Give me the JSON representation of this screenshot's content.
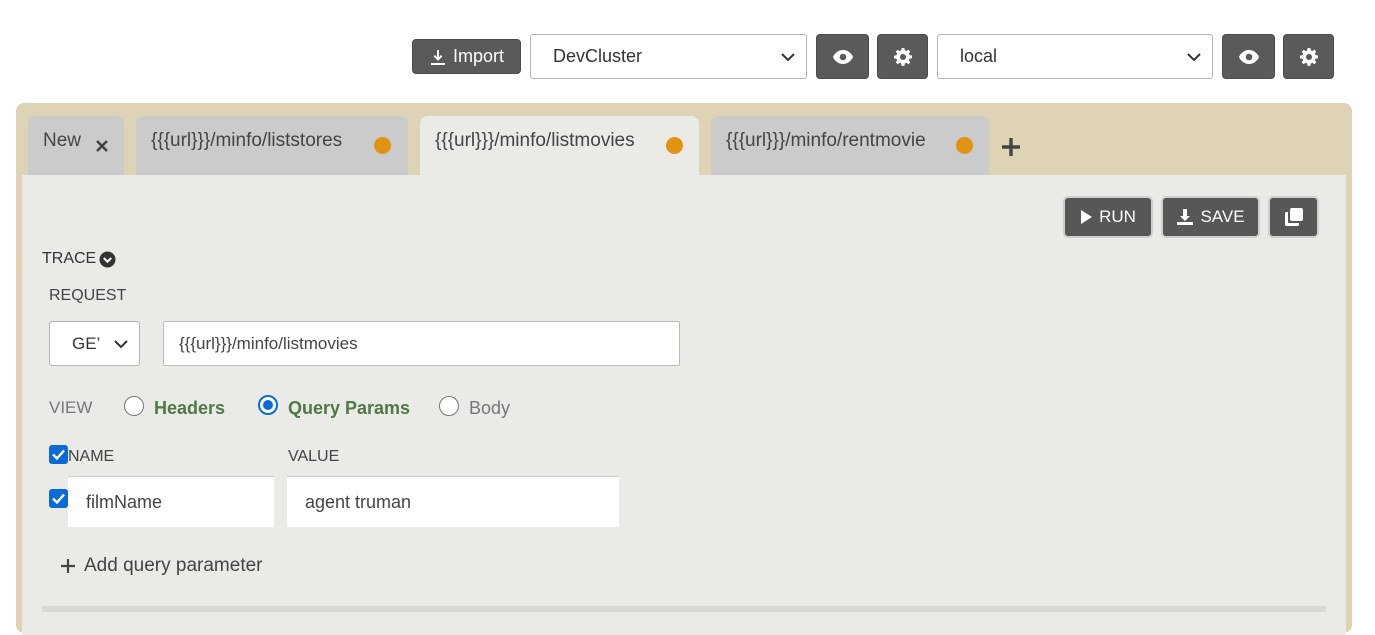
{
  "toolbar": {
    "import_label": "Import",
    "cluster_select": "DevCluster",
    "env_select": "local"
  },
  "tabs": [
    {
      "label": "New",
      "active": false,
      "dirty": false
    },
    {
      "label": "{{{url}}}/minfo/liststores",
      "active": false,
      "dirty": true
    },
    {
      "label": "{{{url}}}/minfo/listmovies",
      "active": true,
      "dirty": true
    },
    {
      "label": "{{{url}}}/minfo/rentmovie",
      "active": false,
      "dirty": true
    }
  ],
  "actions": {
    "run_label": "RUN",
    "save_label": "SAVE"
  },
  "trace_label": "TRACE",
  "request": {
    "section_label": "REQUEST",
    "method": "GE’",
    "url": "{{{url}}}/minfo/listmovies"
  },
  "view": {
    "label": "VIEW",
    "options": [
      "Headers",
      "Query Params",
      "Body"
    ],
    "selected": "Query Params"
  },
  "params": {
    "name_header": "NAME",
    "value_header": "VALUE",
    "rows": [
      {
        "name": "filmName",
        "value": "agent truman",
        "enabled": true
      }
    ],
    "add_label": "Add query parameter"
  },
  "colors": {
    "accent": "#0b6bd6",
    "dirty_dot": "#e19412",
    "workspace_bg": "#dfd3b6",
    "panel_bg": "#eaeae6",
    "view_option_active": "#4e7a45"
  }
}
